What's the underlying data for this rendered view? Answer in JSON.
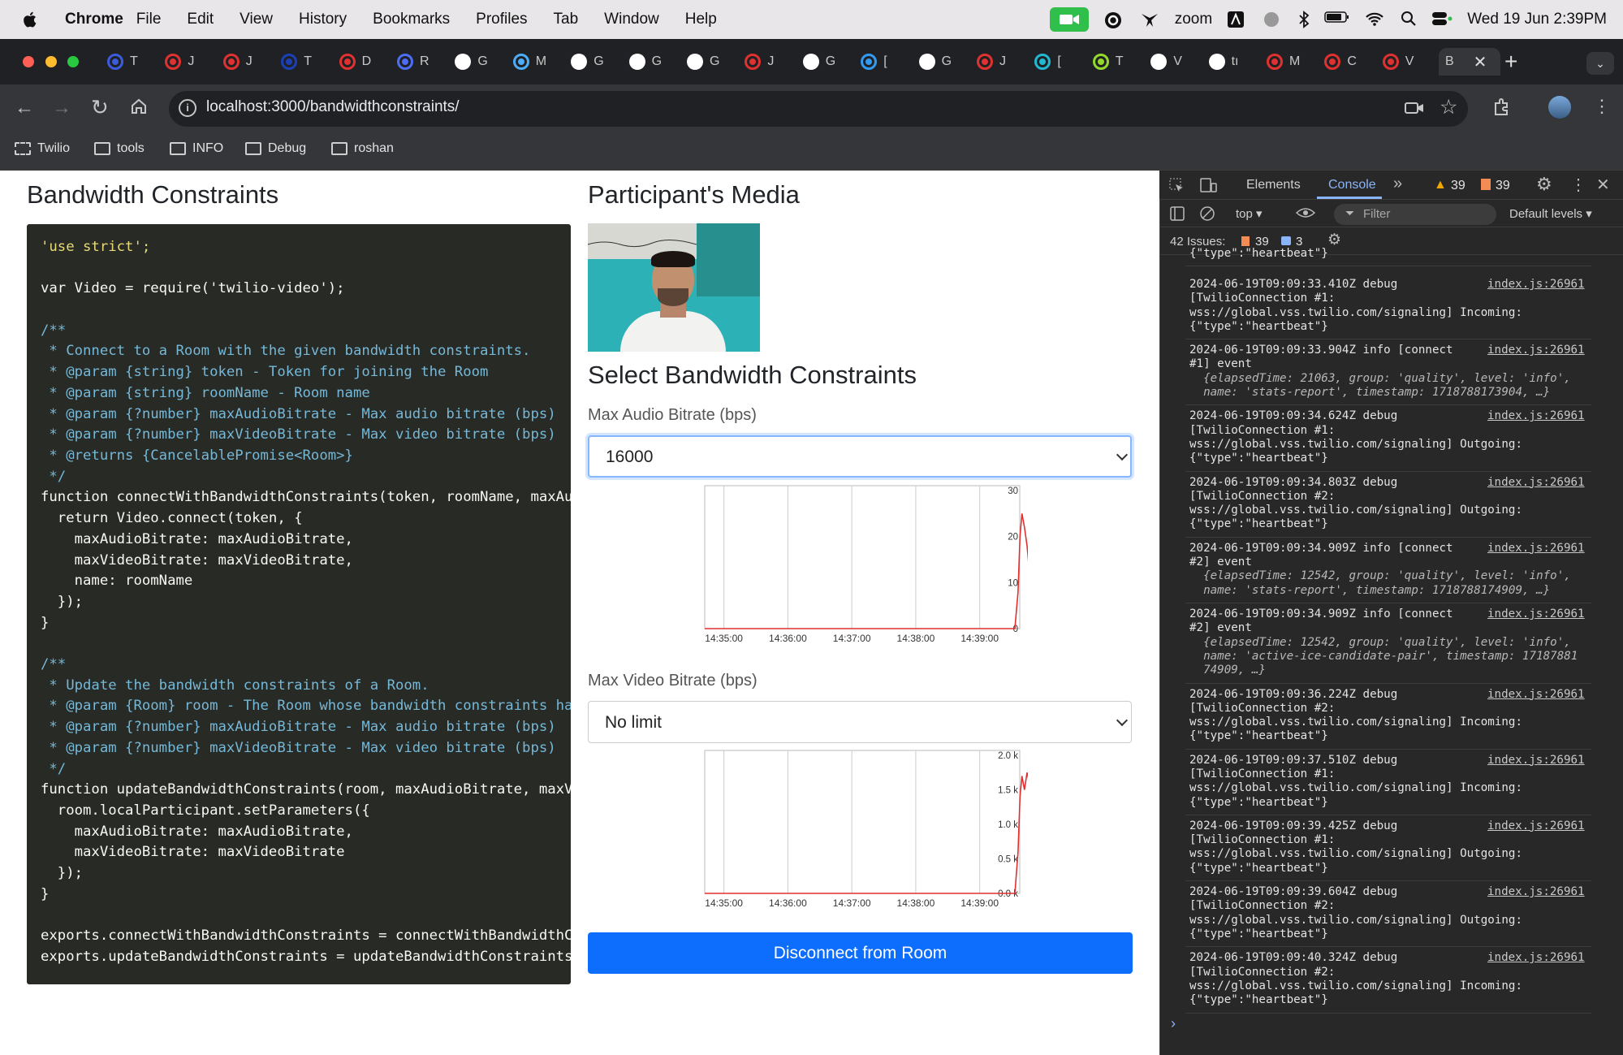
{
  "menubar": {
    "app": "Chrome",
    "items": [
      "File",
      "Edit",
      "View",
      "History",
      "Bookmarks",
      "Profiles",
      "Tab",
      "Window",
      "Help"
    ],
    "zoom_label": "zoom",
    "datetime": "Wed 19 Jun  2:39PM"
  },
  "tabs": [
    {
      "letter": "T",
      "color": "#3b5bdb"
    },
    {
      "letter": "J",
      "color": "#e03131"
    },
    {
      "letter": "J",
      "color": "#e03131"
    },
    {
      "letter": "T",
      "color": "#1c3fb8"
    },
    {
      "letter": "D",
      "color": "#e03131"
    },
    {
      "letter": "R",
      "color": "#4c6ef5"
    },
    {
      "letter": "G",
      "color": "#ffffff"
    },
    {
      "letter": "M",
      "color": "#4dabf7"
    },
    {
      "letter": "G",
      "color": "#ffffff"
    },
    {
      "letter": "G",
      "color": "#ffffff"
    },
    {
      "letter": "G",
      "color": "#ffffff"
    },
    {
      "letter": "J",
      "color": "#e03131"
    },
    {
      "letter": "G",
      "color": "#ffffff"
    },
    {
      "letter": "[",
      "color": "#339af0"
    },
    {
      "letter": "G",
      "color": "#ffffff"
    },
    {
      "letter": "J",
      "color": "#e03131"
    },
    {
      "letter": "[",
      "color": "#22b8cf"
    },
    {
      "letter": "T",
      "color": "#94d82d"
    },
    {
      "letter": "V",
      "color": "#ffffff"
    },
    {
      "letter": "tı",
      "color": "#ffffff"
    },
    {
      "letter": "M",
      "color": "#e03131"
    },
    {
      "letter": "C",
      "color": "#e03131"
    },
    {
      "letter": "V",
      "color": "#e03131"
    }
  ],
  "active_tab": {
    "letter": "B"
  },
  "address": {
    "url": "localhost:3000/bandwidthconstraints/"
  },
  "bookmarks": [
    "Twilio",
    "tools",
    "INFO",
    "Debug",
    "roshan"
  ],
  "page": {
    "title": "Bandwidth Constraints",
    "media_title": "Participant's Media",
    "select_title": "Select Bandwidth Constraints",
    "audio_label": "Max Audio Bitrate (bps)",
    "audio_value": "16000",
    "video_label": "Max Video Bitrate (bps)",
    "video_value": "No limit",
    "disconnect_label": "Disconnect from Room"
  },
  "code_lines": [
    "'use strict';",
    "",
    "var Video = require('twilio-video');",
    "",
    "/**",
    " * Connect to a Room with the given bandwidth constraints.",
    " * @param {string} token - Token for joining the Room",
    " * @param {string} roomName - Room name",
    " * @param {?number} maxAudioBitrate - Max audio bitrate (bps)",
    " * @param {?number} maxVideoBitrate - Max video bitrate (bps)",
    " * @returns {CancelablePromise<Room>}",
    " */",
    "function connectWithBandwidthConstraints(token, roomName, maxAu",
    "  return Video.connect(token, {",
    "    maxAudioBitrate: maxAudioBitrate,",
    "    maxVideoBitrate: maxVideoBitrate,",
    "    name: roomName",
    "  });",
    "}",
    "",
    "/**",
    " * Update the bandwidth constraints of a Room.",
    " * @param {Room} room - The Room whose bandwidth constraints hav",
    " * @param {?number} maxAudioBitrate - Max audio bitrate (bps)",
    " * @param {?number} maxVideoBitrate - Max video bitrate (bps)",
    " */",
    "function updateBandwidthConstraints(room, maxAudioBitrate, maxVi",
    "  room.localParticipant.setParameters({",
    "    maxAudioBitrate: maxAudioBitrate,",
    "    maxVideoBitrate: maxVideoBitrate",
    "  });",
    "}",
    "",
    "exports.connectWithBandwidthConstraints = connectWithBandwidthCo",
    "exports.updateBandwidthConstraints = updateBandwidthConstraints"
  ],
  "chart_data": [
    {
      "type": "line",
      "x_ticks": [
        "14:35:00",
        "14:36:00",
        "14:37:00",
        "14:38:00",
        "14:39:00"
      ],
      "y_ticks": [
        "0",
        "10",
        "20",
        "30"
      ],
      "ylim": [
        0,
        30
      ],
      "series": [
        {
          "values_x_minutes_after_1435": [
            0,
            4.55,
            4.6,
            4.63,
            4.66,
            4.7,
            4.74,
            4.78,
            4.8
          ],
          "values": [
            0,
            0,
            8,
            20,
            25,
            22,
            18,
            12,
            10
          ]
        }
      ]
    },
    {
      "type": "line",
      "x_ticks": [
        "14:35:00",
        "14:36:00",
        "14:37:00",
        "14:38:00",
        "14:39:00"
      ],
      "y_ticks": [
        "0.0 k",
        "0.5 k",
        "1.0 k",
        "1.5 k",
        "2.0 k"
      ],
      "ylim": [
        0,
        2000
      ],
      "series": [
        {
          "values_x_minutes_after_1435": [
            0,
            4.55,
            4.6,
            4.63,
            4.66,
            4.7,
            4.74,
            4.78,
            4.8
          ],
          "values": [
            0,
            0,
            600,
            1400,
            1700,
            1500,
            1750,
            1600,
            1650
          ]
        }
      ]
    }
  ],
  "devtools": {
    "tabs": [
      "Elements",
      "Console"
    ],
    "warnings": "39",
    "errors": "39",
    "context": "top",
    "filter_placeholder": "Filter",
    "levels": "Default levels",
    "issues_label": "42 Issues:",
    "issues_warn": "39",
    "issues_info": "3"
  },
  "console_logs": [
    {
      "lines": [
        "{\"type\":\"heartbeat\"}"
      ]
    },
    {
      "link": "index.js:26961",
      "lines": [
        "2024-06-19T09:09:33.410Z debug",
        "[TwilioConnection #1:",
        "wss://global.vss.twilio.com/signaling] Incoming:",
        "{\"type\":\"heartbeat\"}"
      ]
    },
    {
      "link": "index.js:26961",
      "lines": [
        "2024-06-19T09:09:33.904Z info [connect",
        "#1] event",
        "  {elapsedTime: 21063, group: 'quality', level: 'info',",
        "  name: 'stats-report', timestamp: 1718788173904, …}"
      ]
    },
    {
      "link": "index.js:26961",
      "lines": [
        "2024-06-19T09:09:34.624Z debug",
        "[TwilioConnection #1:",
        "wss://global.vss.twilio.com/signaling] Outgoing:",
        "{\"type\":\"heartbeat\"}"
      ]
    },
    {
      "link": "index.js:26961",
      "lines": [
        "2024-06-19T09:09:34.803Z debug",
        "[TwilioConnection #2:",
        "wss://global.vss.twilio.com/signaling] Outgoing:",
        "{\"type\":\"heartbeat\"}"
      ]
    },
    {
      "link": "index.js:26961",
      "lines": [
        "2024-06-19T09:09:34.909Z info [connect",
        "#2] event",
        "  {elapsedTime: 12542, group: 'quality', level: 'info',",
        "  name: 'stats-report', timestamp: 1718788174909, …}"
      ]
    },
    {
      "link": "index.js:26961",
      "lines": [
        "2024-06-19T09:09:34.909Z info [connect",
        "#2] event",
        "  {elapsedTime: 12542, group: 'quality', level: 'info',",
        "  name: 'active-ice-candidate-pair', timestamp: 17187881",
        "  74909, …}"
      ]
    },
    {
      "link": "index.js:26961",
      "lines": [
        "2024-06-19T09:09:36.224Z debug",
        "[TwilioConnection #2:",
        "wss://global.vss.twilio.com/signaling] Incoming:",
        "{\"type\":\"heartbeat\"}"
      ]
    },
    {
      "link": "index.js:26961",
      "lines": [
        "2024-06-19T09:09:37.510Z debug",
        "[TwilioConnection #1:",
        "wss://global.vss.twilio.com/signaling] Incoming:",
        "{\"type\":\"heartbeat\"}"
      ]
    },
    {
      "link": "index.js:26961",
      "lines": [
        "2024-06-19T09:09:39.425Z debug",
        "[TwilioConnection #1:",
        "wss://global.vss.twilio.com/signaling] Outgoing:",
        "{\"type\":\"heartbeat\"}"
      ]
    },
    {
      "link": "index.js:26961",
      "lines": [
        "2024-06-19T09:09:39.604Z debug",
        "[TwilioConnection #2:",
        "wss://global.vss.twilio.com/signaling] Outgoing:",
        "{\"type\":\"heartbeat\"}"
      ]
    },
    {
      "link": "index.js:26961",
      "lines": [
        "2024-06-19T09:09:40.324Z debug",
        "[TwilioConnection #2:",
        "wss://global.vss.twilio.com/signaling] Incoming:",
        "{\"type\":\"heartbeat\"}"
      ]
    }
  ],
  "colors": {
    "accent": "#0d6efd",
    "chart_line": "#e03131",
    "devtools_bg": "#282828",
    "code_bg": "#282a26"
  }
}
